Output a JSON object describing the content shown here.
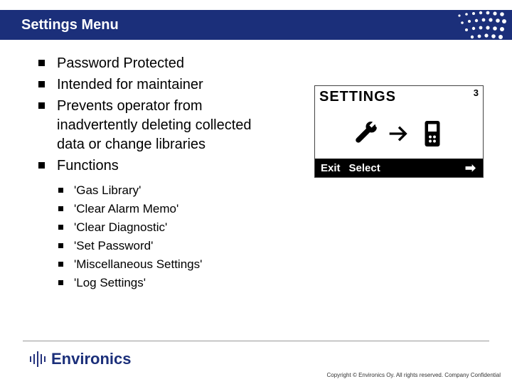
{
  "title": "Settings Menu",
  "bullets": [
    "Password Protected",
    "Intended for maintainer",
    "Prevents operator from inadvertently deleting collected data or change libraries",
    "Functions"
  ],
  "subbullets": [
    "'Gas Library'",
    "'Clear Alarm Memo'",
    "'Clear Diagnostic'",
    "'Set Password'",
    "'Miscellaneous Settings'",
    "'Log Settings'"
  ],
  "device": {
    "heading": "SETTINGS",
    "number": "3",
    "exit": "Exit",
    "select": "Select",
    "arrow": "➡"
  },
  "logo_text": "Environics",
  "copyright": "Copyright © Environics Oy. All rights reserved. Company Confidential"
}
